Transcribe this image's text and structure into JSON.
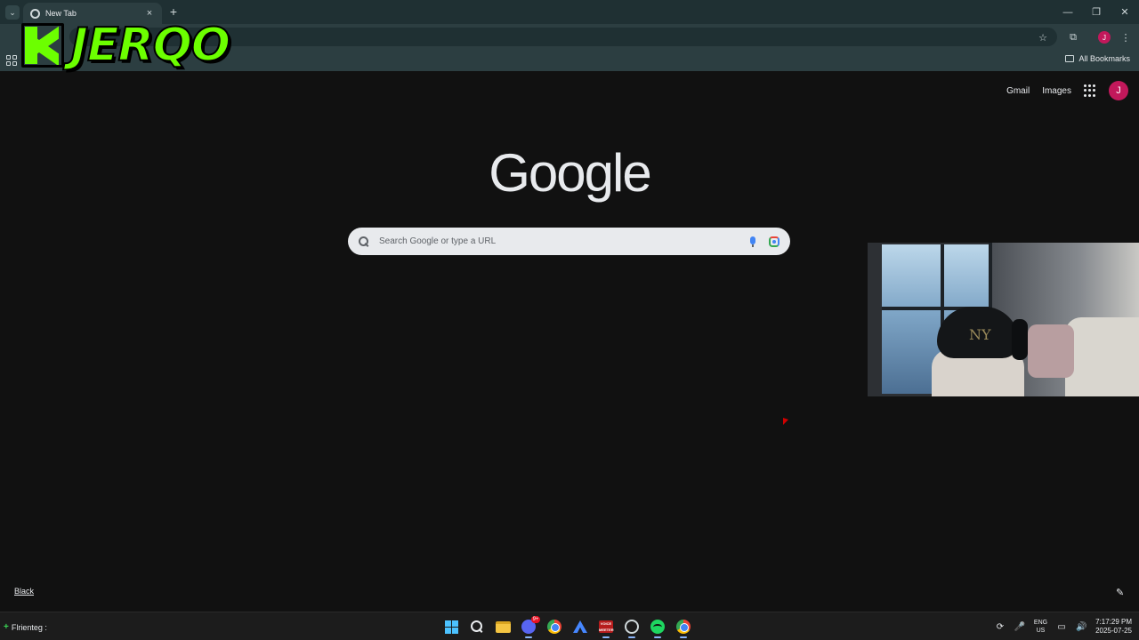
{
  "browser": {
    "tab_title": "New Tab",
    "new_tab_symbol": "+",
    "tab_close_symbol": "×",
    "tab_search_symbol": "⌄",
    "window_controls": [
      "—",
      "❐",
      "✕"
    ],
    "toolbar_icons": {
      "star": "☆",
      "extensions": "⧉",
      "menu": "⋮"
    },
    "profile_initial": "J",
    "bookmarks_label": "All Bookmarks"
  },
  "overlay": {
    "streamer_name": "JERQO"
  },
  "google": {
    "links": [
      "Gmail",
      "Images"
    ],
    "avatar_initial": "J",
    "logo_text": "Google",
    "search_placeholder": "Search Google or type a URL",
    "search_value": ""
  },
  "customize": {
    "background_label": "Black",
    "edit_symbol": "✎"
  },
  "webcam": {
    "cap_logo": "NY"
  },
  "taskbar": {
    "left_label": "Flrienteg :",
    "discord_badge": "9+",
    "voicemeeter_label": "VOICE MEETER",
    "lang_top": "ENG",
    "lang_bottom": "US",
    "time": "7:17:29 PM",
    "date": "2025-07-25",
    "tray": {
      "refresh": "⟳",
      "mic": "🎤",
      "display": "▭",
      "volume": "🔊"
    }
  },
  "colors": {
    "accent_green": "#6cff00",
    "profile_pink": "#c2185b",
    "chrome_frame": "#2c3e41"
  }
}
